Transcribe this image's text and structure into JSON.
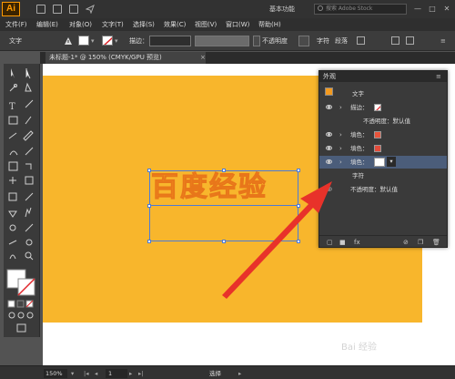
{
  "app": {
    "logo": "Ai",
    "workspace": "基本功能",
    "stock_search_placeholder": "搜索 Adobe Stock",
    "window_controls": [
      "—",
      "□",
      "✕"
    ]
  },
  "menu": [
    "文件(F)",
    "编辑(E)",
    "对象(O)",
    "文字(T)",
    "选择(S)",
    "效果(C)",
    "视图(V)",
    "窗口(W)",
    "帮助(H)"
  ],
  "control_bar": {
    "object_type": "文字",
    "stroke_label": "描边：",
    "opacity_label": "不透明度",
    "char_label": "字符",
    "para_label": "段落"
  },
  "document": {
    "tab_title": "未标题-1* @ 150% (CMYK/GPU 预览)",
    "close_glyph": "×"
  },
  "canvas": {
    "headline": "百度经验",
    "artboard_color": "#f8b62c",
    "text_color": "#f59a1b",
    "selection_color": "#4d7bd6"
  },
  "appearance_panel": {
    "title": "外观",
    "menu_glyph": "≡",
    "header_label": "文字",
    "rows": [
      {
        "label": "描边：",
        "swatch": "none",
        "chevron": "›",
        "selected": false
      },
      {
        "label": "不透明度：默认值",
        "swatch": "",
        "chevron": "",
        "selected": false
      },
      {
        "label": "填色：",
        "swatch": "#e8543b",
        "chevron": "›",
        "selected": false
      },
      {
        "label": "填色：",
        "swatch": "#e34b3a",
        "chevron": "›",
        "selected": false
      },
      {
        "label": "填色：",
        "swatch": "#ffffff",
        "chevron": "›",
        "selected": true
      },
      {
        "label": "字符",
        "swatch": "",
        "chevron": "",
        "selected": false
      },
      {
        "label": "不透明度：默认值",
        "swatch": "",
        "chevron": "",
        "selected": false
      }
    ]
  },
  "status_bar": {
    "zoom": "150%",
    "page": "1",
    "tool_name": "选择"
  },
  "annotation": {
    "arrow_color": "#e8322a",
    "watermark": "Bai 经验"
  }
}
